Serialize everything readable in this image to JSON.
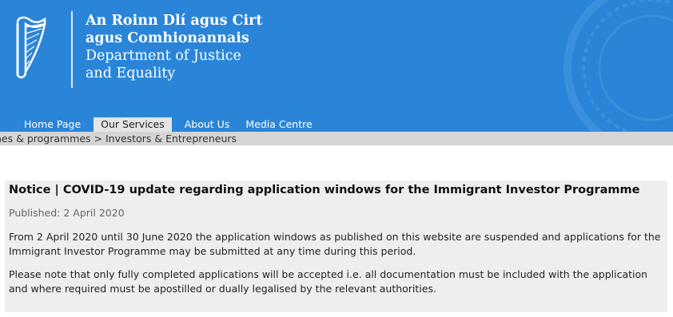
{
  "header": {
    "dept_irish_line1": "An Roinn Dlí agus Cirt",
    "dept_irish_line2": "agus Comhionannais",
    "dept_english_line1": "Department of Justice",
    "dept_english_line2": "and Equality",
    "logo_icon": "harp-icon",
    "background_color": "#2a85d8"
  },
  "nav": {
    "items": [
      {
        "label": "Home Page",
        "active": false
      },
      {
        "label": "Our Services",
        "active": true
      },
      {
        "label": "About Us",
        "active": false
      },
      {
        "label": "Media Centre",
        "active": false
      }
    ]
  },
  "breadcrumb": {
    "text": "nes & programmes > Investors & Entrepreneurs"
  },
  "notice": {
    "title": "Notice | COVID-19 update regarding application windows for the Immigrant Investor Programme",
    "published": "Published: 2 April 2020",
    "paragraph1": "From 2 April 2020 until 30 June 2020 the application windows as published on this website are suspended and applications for the Immigrant Investor Programme may be submitted at any time during this period.",
    "paragraph2": "Please note that only fully completed applications will be accepted i.e. all documentation must be included with the application and where required must be apostilled or dually legalised by the relevant authorities."
  }
}
